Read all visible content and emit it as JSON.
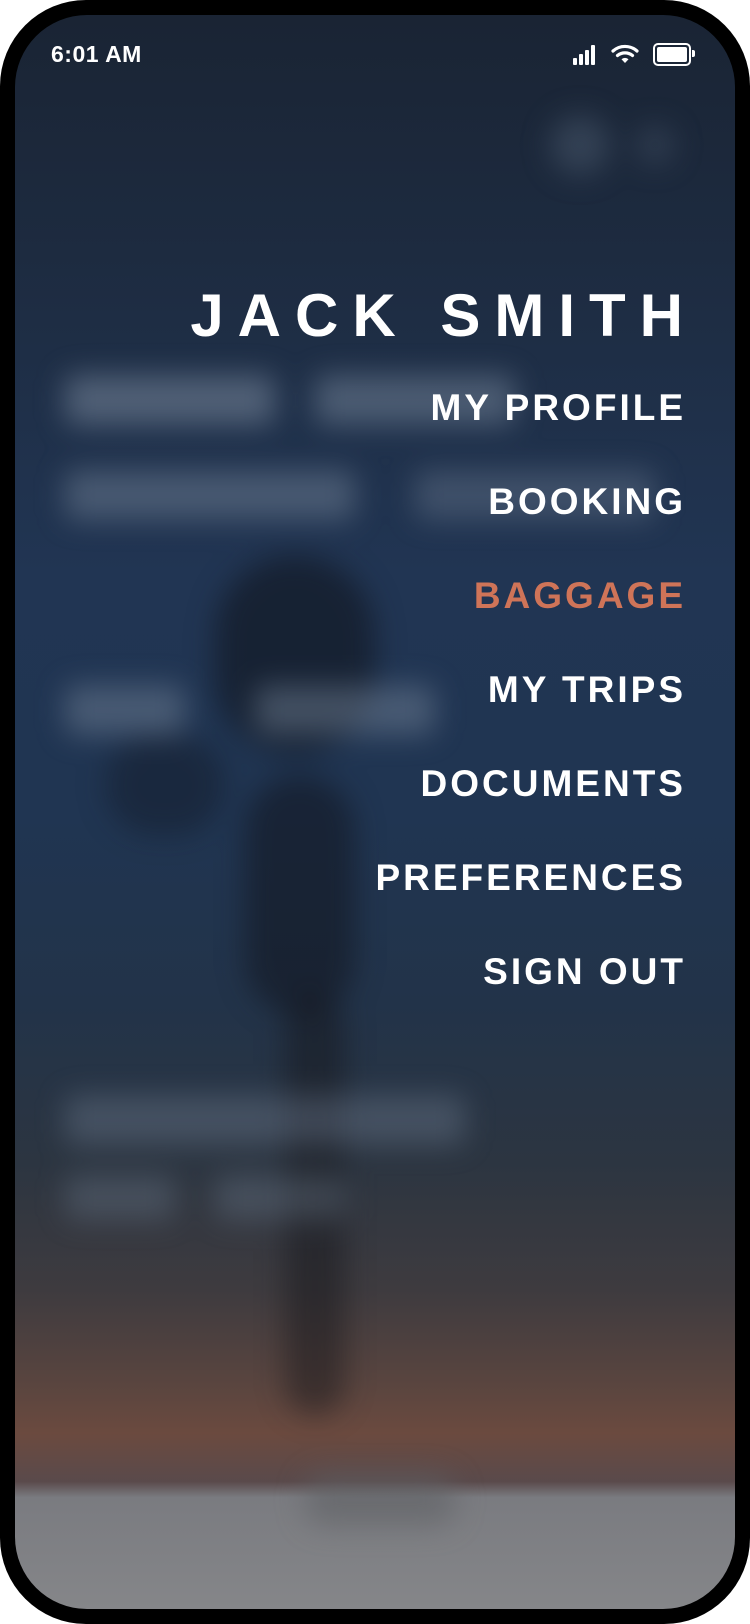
{
  "status_bar": {
    "time": "6:01 AM",
    "icons": [
      "cellular-signal-icon",
      "wifi-icon",
      "battery-icon"
    ]
  },
  "menu": {
    "user_name": "JACK SMITH",
    "items": [
      {
        "label": "MY PROFILE",
        "active": false
      },
      {
        "label": "BOOKING",
        "active": false
      },
      {
        "label": "BAGGAGE",
        "active": true
      },
      {
        "label": "MY TRIPS",
        "active": false
      },
      {
        "label": "DOCUMENTS",
        "active": false
      },
      {
        "label": "PREFERENCES",
        "active": false
      },
      {
        "label": "SIGN OUT",
        "active": false
      }
    ]
  },
  "colors": {
    "text": "#ffffff",
    "active_item": "#cf7458",
    "background_top": "#1a2434",
    "background_mid": "#213553",
    "background_bottom": "#6b4a3f"
  }
}
